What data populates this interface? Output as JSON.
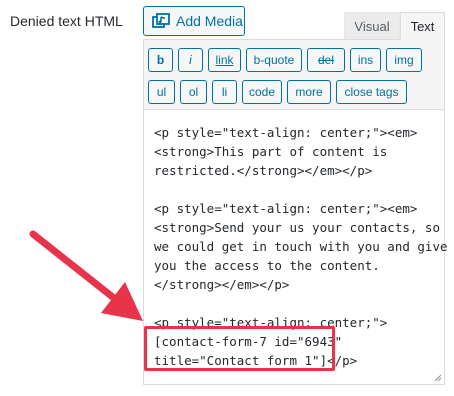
{
  "field": {
    "label": "Denied text HTML"
  },
  "media": {
    "add_label": "Add Media",
    "icon": "media-icon"
  },
  "tabs": {
    "visual": "Visual",
    "text": "Text",
    "active": "Text"
  },
  "toolbar": {
    "buttons": [
      "b",
      "i",
      "link",
      "b-quote",
      "del",
      "ins",
      "img",
      "ul",
      "ol",
      "li",
      "code",
      "more",
      "close tags"
    ]
  },
  "editor": {
    "lines": [
      "<p style=\"text-align: center;\"><em>",
      "<strong>This part of content is",
      "restricted.</strong></em></p>",
      "",
      "<p style=\"text-align: center;\"><em>",
      "<strong>Send your us your contacts, so",
      "we could get in touch with you and give",
      "you the access to the content.",
      "</strong></em></p>",
      "",
      "<p style=\"text-align: center;\">",
      "[contact-form-7 id=\"6943\"",
      "title=\"Contact form 1\"]</p>"
    ]
  },
  "annotation": {
    "highlight_color": "#e8344a",
    "arrow_color": "#e8344a"
  },
  "colors": {
    "accent": "#0071a1",
    "toolbar_bg": "#f5f5f5",
    "border": "#dcdcde"
  }
}
